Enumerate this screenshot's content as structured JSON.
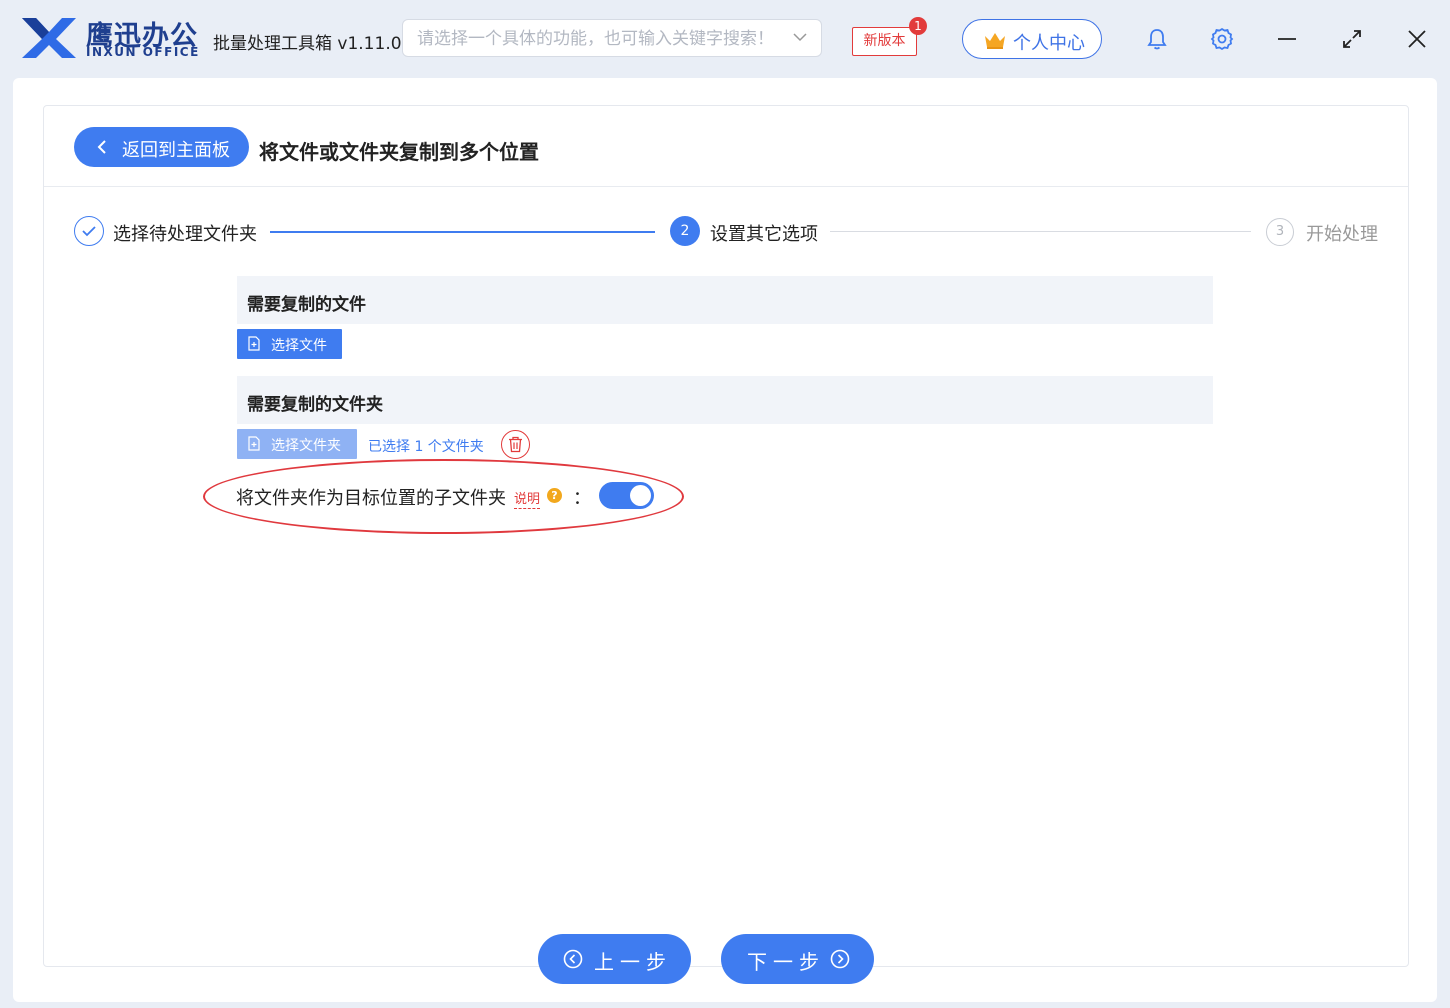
{
  "app": {
    "logo_cn": "鹰迅办公",
    "logo_en": "INXUN OFFICE",
    "title": "批量处理工具箱 v1.11.0",
    "brand_color": "#3f7cf0"
  },
  "search": {
    "placeholder": "请选择一个具体的功能，也可输入关键字搜索！"
  },
  "header": {
    "new_version_label": "新版本",
    "new_version_badge": "1",
    "personal_center_label": "个人中心",
    "icons": [
      "bell-icon",
      "gear-icon",
      "minimize-icon",
      "maximize-icon",
      "close-icon"
    ]
  },
  "page": {
    "back_label": "返回到主面板",
    "title": "将文件或文件夹复制到多个位置"
  },
  "steps": [
    {
      "number": "1",
      "label": "选择待处理文件夹",
      "state": "done"
    },
    {
      "number": "2",
      "label": "设置其它选项",
      "state": "active"
    },
    {
      "number": "3",
      "label": "开始处理",
      "state": "pending"
    }
  ],
  "files_section": {
    "title": "需要复制的文件",
    "button_label": "选择文件"
  },
  "folders_section": {
    "title": "需要复制的文件夹",
    "button_label": "选择文件夹",
    "selected_info": "已选择 1 个文件夹"
  },
  "option": {
    "label": "将文件夹作为目标位置的子文件夹",
    "explain_label": "说明",
    "help_glyph": "?",
    "colon": "：",
    "enabled": true
  },
  "footer": {
    "prev_label": "上一步",
    "next_label": "下一步"
  }
}
